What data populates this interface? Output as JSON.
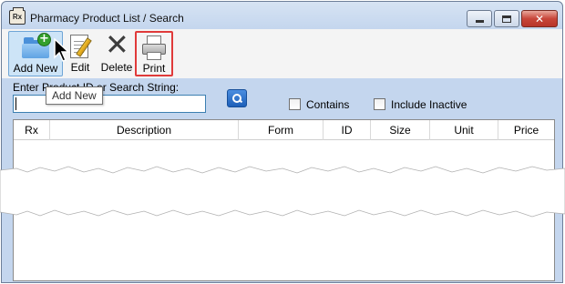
{
  "window": {
    "title": "Pharmacy Product List / Search",
    "app_icon_text": "Rx",
    "controls": {
      "minimize": "minimize",
      "maximize": "maximize",
      "close": "✕"
    }
  },
  "toolbar": {
    "add_new_label": "Add New",
    "edit_label": "Edit",
    "delete_label": "Delete",
    "print_label": "Print",
    "highlight_color": "#e03a3a"
  },
  "tooltip": {
    "text": "Add New"
  },
  "search": {
    "label": "Enter Product ID or Search String:",
    "value": "",
    "button_icon": "search-icon"
  },
  "options": {
    "contains_label": "Contains",
    "contains_checked": false,
    "include_inactive_label": "Include Inactive",
    "include_inactive_checked": false
  },
  "grid": {
    "columns": [
      "Rx",
      "Description",
      "Form",
      "ID",
      "Size",
      "Unit",
      "Price"
    ],
    "rows": []
  }
}
